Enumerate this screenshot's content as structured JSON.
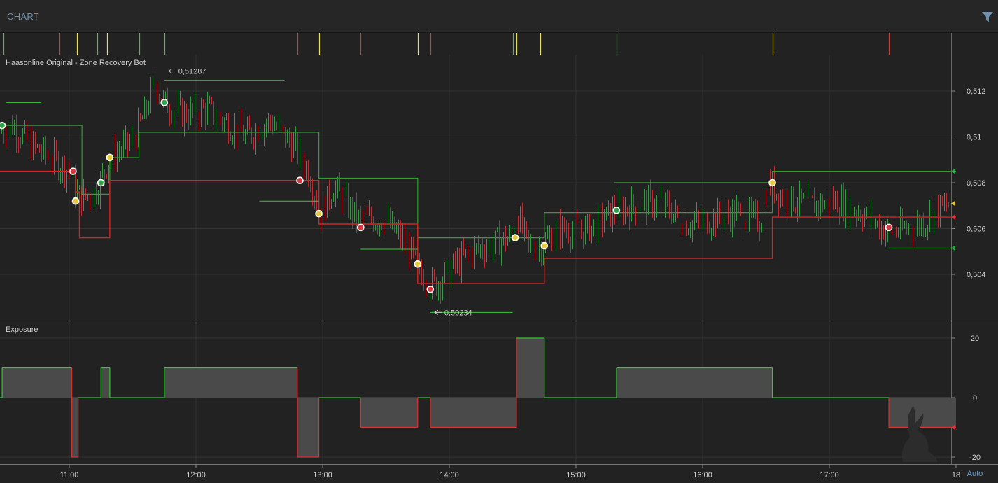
{
  "header": {
    "title": "CHART",
    "filter_icon": "filter-icon"
  },
  "chart_data": [
    {
      "type": "candlestick",
      "title": "Haasonline Original - Zone Recovery Bot",
      "x_ticks": [
        "11:00",
        "12:00",
        "13:00",
        "14:00",
        "15:00",
        "16:00",
        "17:00",
        "18"
      ],
      "y_ticks": [
        "0,512",
        "0,51",
        "0,508",
        "0,506",
        "0,504"
      ],
      "y_tick_values": [
        0.512,
        0.51,
        0.508,
        0.506,
        0.504
      ],
      "y_range": [
        0.5014,
        0.5153
      ],
      "x_range_hours": [
        10.45,
        18.0
      ],
      "grid": true,
      "annotations": [
        {
          "label": "0,51287",
          "value": 0.51287,
          "time": 11.75
        },
        {
          "label": "0,50234",
          "value": 0.50234,
          "time": 13.85
        }
      ],
      "price_path": [
        [
          10.45,
          0.5102
        ],
        [
          10.55,
          0.5105
        ],
        [
          10.7,
          0.5096
        ],
        [
          10.85,
          0.5091
        ],
        [
          11.0,
          0.5085
        ],
        [
          11.05,
          0.5076
        ],
        [
          11.1,
          0.5073
        ],
        [
          11.2,
          0.5076
        ],
        [
          11.25,
          0.5081
        ],
        [
          11.32,
          0.5091
        ],
        [
          11.5,
          0.5098
        ],
        [
          11.6,
          0.511
        ],
        [
          11.68,
          0.5124
        ],
        [
          11.75,
          0.5115
        ],
        [
          11.9,
          0.511
        ],
        [
          12.1,
          0.5112
        ],
        [
          12.2,
          0.5108
        ],
        [
          12.4,
          0.51
        ],
        [
          12.6,
          0.5107
        ],
        [
          12.8,
          0.5095
        ],
        [
          12.9,
          0.5085
        ],
        [
          13.0,
          0.5067
        ],
        [
          13.1,
          0.5078
        ],
        [
          13.3,
          0.5064
        ],
        [
          13.5,
          0.5064
        ],
        [
          13.7,
          0.5052
        ],
        [
          13.78,
          0.504
        ],
        [
          13.9,
          0.5035
        ],
        [
          14.05,
          0.5043
        ],
        [
          14.2,
          0.505
        ],
        [
          14.4,
          0.5054
        ],
        [
          14.52,
          0.5056
        ],
        [
          14.55,
          0.5068
        ],
        [
          14.65,
          0.5052
        ],
        [
          14.75,
          0.5052
        ],
        [
          14.9,
          0.506
        ],
        [
          15.1,
          0.5059
        ],
        [
          15.32,
          0.5067
        ],
        [
          15.5,
          0.507
        ],
        [
          15.7,
          0.5072
        ],
        [
          15.9,
          0.5062
        ],
        [
          16.1,
          0.5064
        ],
        [
          16.3,
          0.5067
        ],
        [
          16.5,
          0.5063
        ],
        [
          16.55,
          0.508
        ],
        [
          16.7,
          0.5073
        ],
        [
          16.9,
          0.507
        ],
        [
          17.1,
          0.5072
        ],
        [
          17.3,
          0.5067
        ],
        [
          17.47,
          0.506
        ],
        [
          17.6,
          0.5059
        ],
        [
          17.8,
          0.5063
        ],
        [
          17.9,
          0.5068
        ],
        [
          18.0,
          0.507
        ]
      ],
      "zone_upper_green": [
        [
          10.45,
          0.5105
        ],
        [
          11.1,
          0.5105
        ],
        [
          11.1,
          0.5075
        ],
        [
          11.32,
          0.5075
        ],
        [
          11.32,
          0.5091
        ],
        [
          11.55,
          0.5091
        ],
        [
          11.55,
          0.5102
        ],
        [
          12.97,
          0.5102
        ],
        [
          12.97,
          0.5082
        ],
        [
          13.75,
          0.5082
        ],
        [
          13.75,
          0.5056
        ],
        [
          14.75,
          0.5056
        ],
        [
          14.75,
          0.5067
        ],
        [
          16.55,
          0.5067
        ],
        [
          16.55,
          0.5085
        ],
        [
          18.0,
          0.5085
        ]
      ],
      "zone_lower_red": [
        [
          10.45,
          0.5085
        ],
        [
          11.05,
          0.5085
        ],
        [
          11.05,
          0.5076
        ],
        [
          11.08,
          0.5076
        ],
        [
          11.08,
          0.5056
        ],
        [
          11.32,
          0.5056
        ],
        [
          11.32,
          0.5081
        ],
        [
          12.97,
          0.5081
        ],
        [
          12.97,
          0.5062
        ],
        [
          13.75,
          0.5062
        ],
        [
          13.75,
          0.5036
        ],
        [
          14.65,
          0.5036
        ],
        [
          14.65,
          0.5036
        ],
        [
          14.75,
          0.5036
        ],
        [
          14.75,
          0.5047
        ],
        [
          16.55,
          0.5047
        ],
        [
          16.55,
          0.5065
        ],
        [
          18.0,
          0.5065
        ]
      ],
      "target_lines": [
        [
          10.5,
          10.78,
          0.5115
        ],
        [
          11.75,
          12.7,
          0.51245
        ],
        [
          12.5,
          12.97,
          0.5072
        ],
        [
          13.3,
          13.75,
          0.5051
        ],
        [
          13.85,
          14.5,
          0.50234
        ],
        [
          15.3,
          16.55,
          0.508
        ],
        [
          17.47,
          18.0,
          0.50515
        ]
      ],
      "markers": [
        {
          "time": 10.47,
          "value": 0.5105,
          "fill": "#2ea84a"
        },
        {
          "time": 11.03,
          "value": 0.5085,
          "fill": "#d9363e"
        },
        {
          "time": 11.05,
          "value": 0.5072,
          "fill": "#e8c93a"
        },
        {
          "time": 11.25,
          "value": 0.508,
          "fill": "#2ea84a"
        },
        {
          "time": 11.32,
          "value": 0.5091,
          "fill": "#e8c93a"
        },
        {
          "time": 11.75,
          "value": 0.5115,
          "fill": "#2ea84a"
        },
        {
          "time": 12.82,
          "value": 0.5081,
          "fill": "#d9363e"
        },
        {
          "time": 12.97,
          "value": 0.50665,
          "fill": "#e8c93a"
        },
        {
          "time": 13.3,
          "value": 0.50605,
          "fill": "#d9363e"
        },
        {
          "time": 13.75,
          "value": 0.50445,
          "fill": "#e8c93a"
        },
        {
          "time": 13.85,
          "value": 0.50335,
          "fill": "#d9363e"
        },
        {
          "time": 14.52,
          "value": 0.5056,
          "fill": "#e8c93a"
        },
        {
          "time": 14.75,
          "value": 0.50525,
          "fill": "#e8c93a"
        },
        {
          "time": 15.32,
          "value": 0.5068,
          "fill": "#2ea84a"
        },
        {
          "time": 16.55,
          "value": 0.508,
          "fill": "#e8c93a"
        },
        {
          "time": 17.47,
          "value": 0.50605,
          "fill": "#d9363e"
        }
      ],
      "signal_ticks": [
        {
          "time": 10.48,
          "color": "#3cc83c"
        },
        {
          "time": 10.92,
          "color": "#d23a3a"
        },
        {
          "time": 11.06,
          "color": "#e6e05a"
        },
        {
          "time": 11.22,
          "color": "#3cc83c"
        },
        {
          "time": 11.3,
          "color": "#e6e05a"
        },
        {
          "time": 11.55,
          "color": "#3cc83c"
        },
        {
          "time": 11.75,
          "color": "#3cc83c"
        },
        {
          "time": 12.8,
          "color": "#d23a3a"
        },
        {
          "time": 12.97,
          "color": "#e6e05a"
        },
        {
          "time": 13.3,
          "color": "#d23a3a"
        },
        {
          "time": 13.75,
          "color": "#e6e05a"
        },
        {
          "time": 13.85,
          "color": "#d23a3a"
        },
        {
          "time": 14.5,
          "color": "#3cc83c"
        },
        {
          "time": 14.53,
          "color": "#e6e05a"
        },
        {
          "time": 14.72,
          "color": "#e6e05a"
        },
        {
          "time": 15.32,
          "color": "#3cc83c"
        },
        {
          "time": 16.55,
          "color": "#e6e05a"
        },
        {
          "time": 17.47,
          "color": "#d23a3a"
        }
      ],
      "right_arrows": [
        {
          "value": 0.5085,
          "color": "#2ea84a"
        },
        {
          "value": 0.5071,
          "color": "#e8c93a"
        },
        {
          "value": 0.5065,
          "color": "#d9363e"
        },
        {
          "value": 0.50515,
          "color": "#2ea84a"
        }
      ],
      "colors": {
        "up": "#2e9e3e",
        "down": "#c8262c",
        "upper_zone": "#2ea02e",
        "lower_zone": "#dd2020"
      }
    },
    {
      "type": "step-area",
      "title": "Exposure",
      "y_ticks": [
        "20",
        "0",
        "-20"
      ],
      "y_tick_values": [
        20,
        0,
        -20
      ],
      "y_range": [
        -22,
        25
      ],
      "segments": [
        [
          10.45,
          10.47,
          0
        ],
        [
          10.47,
          11.02,
          10
        ],
        [
          11.02,
          11.07,
          -20
        ],
        [
          11.07,
          11.25,
          0
        ],
        [
          11.25,
          11.32,
          10
        ],
        [
          11.32,
          11.75,
          0
        ],
        [
          11.75,
          12.8,
          10
        ],
        [
          12.8,
          12.97,
          -20
        ],
        [
          12.97,
          13.3,
          0
        ],
        [
          13.3,
          13.75,
          -10
        ],
        [
          13.75,
          13.85,
          0
        ],
        [
          13.85,
          14.53,
          -10
        ],
        [
          14.53,
          14.75,
          20
        ],
        [
          14.75,
          15.32,
          0
        ],
        [
          15.32,
          16.55,
          10
        ],
        [
          16.55,
          17.47,
          0
        ],
        [
          17.47,
          18.0,
          -10
        ]
      ],
      "right_arrows": [
        {
          "value": -10,
          "color": "#d9363e"
        }
      ],
      "colors": {
        "positive": "#2ecc2e",
        "negative": "#e03030",
        "fill": "#4a4a4a"
      }
    }
  ],
  "footer": {
    "auto_label": "Auto"
  }
}
